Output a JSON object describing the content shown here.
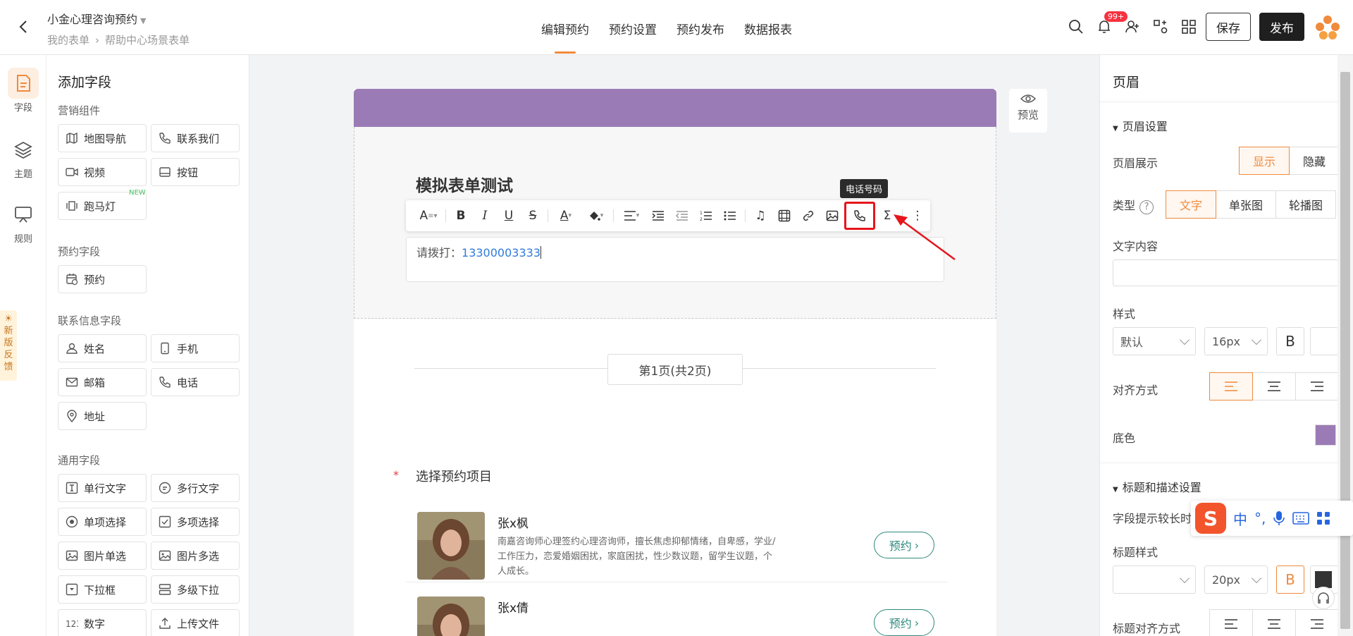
{
  "header": {
    "app_title": "小金心理咨询预约",
    "breadcrumb": [
      "我的表单",
      "帮助中心场景表单"
    ],
    "tabs": [
      "编辑预约",
      "预约设置",
      "预约发布",
      "数据报表"
    ],
    "notification_badge": "99+",
    "save_label": "保存",
    "publish_label": "发布"
  },
  "rail": {
    "items": [
      "字段",
      "主题",
      "规则"
    ],
    "feedback": "新版反馈"
  },
  "fields": {
    "title": "添加字段",
    "groups": [
      {
        "title": "营销组件",
        "items": [
          "地图导航",
          "联系我们",
          "视频",
          "按钮",
          "跑马灯"
        ]
      },
      {
        "title": "预约字段",
        "items": [
          "预约"
        ]
      },
      {
        "title": "联系信息字段",
        "items": [
          "姓名",
          "手机",
          "邮箱",
          "电话",
          "地址"
        ]
      },
      {
        "title": "通用字段",
        "items": [
          "单行文字",
          "多行文字",
          "单项选择",
          "多项选择",
          "图片单选",
          "图片多选",
          "下拉框",
          "多级下拉",
          "数字",
          "上传文件"
        ]
      }
    ],
    "new_tag": "NEW"
  },
  "form": {
    "title": "模拟表单测试",
    "tooltip": "电话号码",
    "editor_prefix": "请拨打：",
    "editor_phone": "13300003333",
    "page_indicator": "第1页(共2页)",
    "question": "选择预约项目",
    "required_mark": "*",
    "cards": [
      {
        "name": "张x枫",
        "desc": "南嘉咨询师心理签约心理咨询师，擅长焦虑抑郁情绪，自卑感，学业/工作压力，恋爱婚姻困扰，家庭困扰，性少数议题，留学生议题，个人成长。",
        "button": "预约"
      },
      {
        "name": "张x倩",
        "desc": "",
        "button": "预约"
      }
    ],
    "preview_label": "预览",
    "header_color": "#9b7bb5"
  },
  "settings": {
    "title": "页眉",
    "section1": "页眉设置",
    "display_label": "页眉展示",
    "display_options": [
      "显示",
      "隐藏"
    ],
    "type_label": "类型",
    "type_options": [
      "文字",
      "单张图",
      "轮播图"
    ],
    "text_content_label": "文字内容",
    "style_label": "样式",
    "style_default": "默认",
    "font_size": "16px",
    "bold_label": "B",
    "align_label": "对齐方式",
    "bg_label": "底色",
    "bg_color": "#9b7bb5",
    "section2": "标题和描述设置",
    "hint_label": "字段提示较长时",
    "title_style_label": "标题样式",
    "title_font_size": "20px",
    "title_align_label": "标题对齐方式"
  },
  "ime": {
    "logo": "S",
    "items": [
      "中",
      "°,"
    ]
  }
}
